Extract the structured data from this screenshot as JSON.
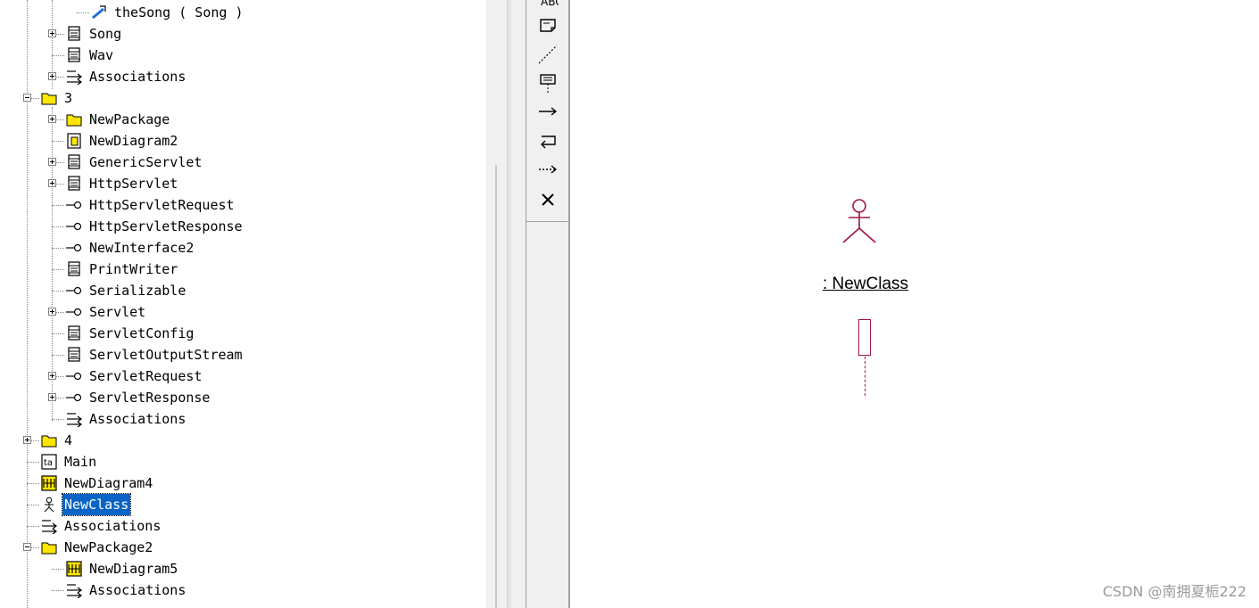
{
  "tree": {
    "items": [
      {
        "label": "theSong ( Song )",
        "icon": "association-role-icon",
        "level": 3,
        "expander": "none"
      },
      {
        "label": "Song",
        "icon": "class-icon",
        "level": 2,
        "expander": "plus"
      },
      {
        "label": "Wav",
        "icon": "class-icon",
        "level": 2,
        "expander": "none"
      },
      {
        "label": "Associations",
        "icon": "associations-icon",
        "level": 2,
        "expander": "plus"
      },
      {
        "label": "3",
        "icon": "folder-icon",
        "level": 1,
        "expander": "minus"
      },
      {
        "label": "NewPackage",
        "icon": "folder-icon",
        "level": 2,
        "expander": "plus"
      },
      {
        "label": "NewDiagram2",
        "icon": "class-diagram-icon",
        "level": 2,
        "expander": "none"
      },
      {
        "label": "GenericServlet",
        "icon": "class-icon",
        "level": 2,
        "expander": "plus"
      },
      {
        "label": "HttpServlet",
        "icon": "class-icon",
        "level": 2,
        "expander": "plus"
      },
      {
        "label": "HttpServletRequest",
        "icon": "interface-icon",
        "level": 2,
        "expander": "none"
      },
      {
        "label": "HttpServletResponse",
        "icon": "interface-icon",
        "level": 2,
        "expander": "none"
      },
      {
        "label": "NewInterface2",
        "icon": "interface-icon",
        "level": 2,
        "expander": "none"
      },
      {
        "label": "PrintWriter",
        "icon": "class-icon",
        "level": 2,
        "expander": "none"
      },
      {
        "label": "Serializable",
        "icon": "interface-icon",
        "level": 2,
        "expander": "none"
      },
      {
        "label": "Servlet",
        "icon": "interface-icon",
        "level": 2,
        "expander": "plus"
      },
      {
        "label": "ServletConfig",
        "icon": "class-icon",
        "level": 2,
        "expander": "none"
      },
      {
        "label": "ServletOutputStream",
        "icon": "class-icon",
        "level": 2,
        "expander": "none"
      },
      {
        "label": "ServletRequest",
        "icon": "interface-icon",
        "level": 2,
        "expander": "plus"
      },
      {
        "label": "ServletResponse",
        "icon": "interface-icon",
        "level": 2,
        "expander": "plus"
      },
      {
        "label": "Associations",
        "icon": "associations-icon",
        "level": 2,
        "expander": "none"
      },
      {
        "label": "4",
        "icon": "folder-icon",
        "level": 1,
        "expander": "plus"
      },
      {
        "label": "Main",
        "icon": "main-diagram-icon",
        "level": 1,
        "expander": "none"
      },
      {
        "label": "NewDiagram4",
        "icon": "sequence-diagram-icon",
        "level": 1,
        "expander": "none"
      },
      {
        "label": "NewClass",
        "icon": "actor-icon",
        "level": 1,
        "expander": "none",
        "selected": true
      },
      {
        "label": "Associations",
        "icon": "associations-icon",
        "level": 1,
        "expander": "none"
      },
      {
        "label": "NewPackage2",
        "icon": "folder-icon",
        "level": 1,
        "expander": "minus"
      },
      {
        "label": "NewDiagram5",
        "icon": "sequence-diagram-icon",
        "level": 2,
        "expander": "none"
      },
      {
        "label": "Associations",
        "icon": "associations-icon",
        "level": 2,
        "expander": "none"
      }
    ]
  },
  "toolbox": {
    "tools": [
      {
        "name": "text-tool-icon"
      },
      {
        "name": "note-tool-icon"
      },
      {
        "name": "anchor-note-icon"
      },
      {
        "name": "object-tool-icon"
      },
      {
        "name": "object-message-icon"
      },
      {
        "name": "message-to-self-icon"
      },
      {
        "name": "return-message-icon"
      },
      {
        "name": "destruction-marker-icon"
      }
    ]
  },
  "diagram": {
    "object_label": ": NewClass"
  },
  "watermark": "CSDN @南拥夏栀222",
  "colors": {
    "actor": "#a0144a",
    "selection": "#0a64c8",
    "folder": "#ffe600"
  }
}
